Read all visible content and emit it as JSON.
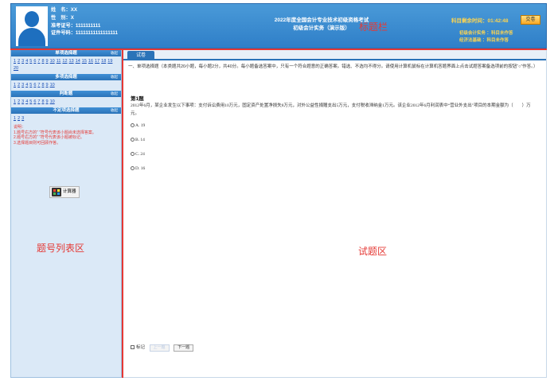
{
  "header": {
    "name_line": "姓　名：XX",
    "gender_line": "性　别：X",
    "exam_id_line": "准考证号：1111111111",
    "id_line": "证件号码：11111111111111111",
    "exam_title_1": "2022年度全国会计专业技术初级资格考试",
    "exam_title_2": "初级会计实务（演示版）",
    "note": "标题栏",
    "timer_label": "科目剩余时间：",
    "timer_value": "01:42:48",
    "submit_label": "交卷",
    "subject_line_1": "初级会计实务 ：科目未作答",
    "subject_line_2": "经济法基础 ：科目未作答"
  },
  "sidebar": {
    "note": "题号列表区",
    "fold_label": "收起",
    "categories": [
      {
        "label": "单项选择题",
        "numbers": [
          "1",
          "2",
          "3",
          "4",
          "5",
          "6",
          "7",
          "8",
          "9",
          "10",
          "11",
          "12",
          "13",
          "14",
          "15",
          "16",
          "17",
          "18",
          "19",
          "20"
        ]
      },
      {
        "label": "多项选择题",
        "numbers": [
          "1",
          "2",
          "3",
          "4",
          "5",
          "6",
          "7",
          "8",
          "9",
          "10"
        ]
      },
      {
        "label": "判断题",
        "numbers": [
          "1",
          "2",
          "3",
          "4",
          "5",
          "6",
          "7",
          "8",
          "9",
          "10"
        ]
      },
      {
        "label": "不定项选择题",
        "numbers": [
          "1",
          "2",
          "3"
        ]
      }
    ],
    "legend_title": "说明：",
    "legend_1": "1.题号右方的“ ”符号代表该小题尚未选择答案。",
    "legend_2": "2.题号右方的“ ”符号代表该小题被标记。",
    "legend_3": "3.选择题目则可回顾作答。",
    "calc_label": "计算器"
  },
  "main": {
    "tab_label": "试卷",
    "instructions": "一、单项选择题（本类题共20小题，每小题2分，共40分。每小题备选答案中，只有一个符合题意的正确答案。错选、不选均不得分。请使用计算机鼠标在计算机答题界面上点击试题答案备选项前的按钮“○”作答。）",
    "question_title": "第1题",
    "question_text": "2012年6月，某企业发生以下事项：支付诉讼费用10万元，固定资产处置净损失8万元，对外公益性捐赠支出5万元，支付税收滞纳金1万元。该企业2012年6月利润表中“营业外支出”项目的本期金额为（　　）万元。",
    "options": [
      "A. 19",
      "B. 14",
      "C. 24",
      "D. 16"
    ],
    "note": "试题区",
    "mark_label": "标记",
    "prev_label": "上一题",
    "next_label": "下一题"
  },
  "colors": {
    "header_blue": "#2f7fc8",
    "note_red": "#e53935",
    "timer_yellow": "#ffd54f"
  }
}
